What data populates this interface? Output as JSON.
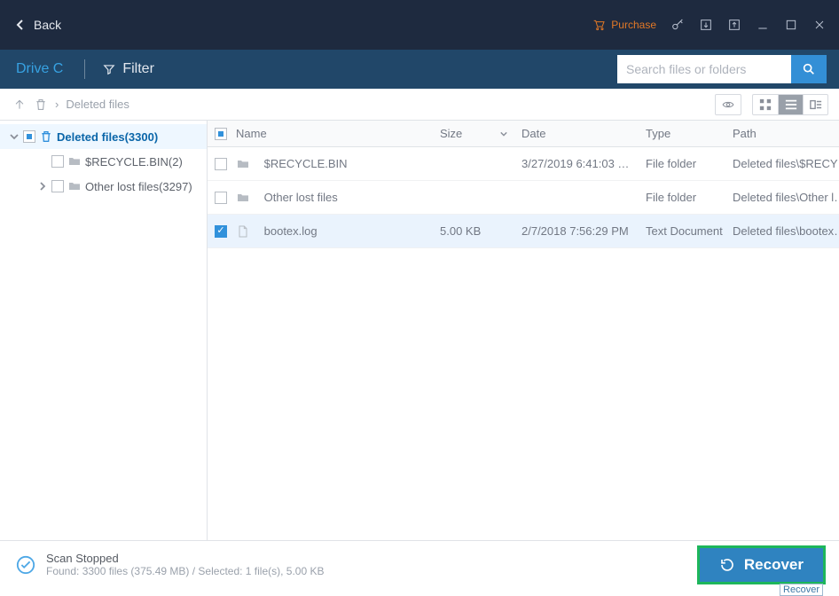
{
  "titlebar": {
    "back_label": "Back",
    "purchase_label": "Purchase"
  },
  "header": {
    "tab_label": "Drive C",
    "filter_label": "Filter"
  },
  "search": {
    "placeholder": "Search files or folders"
  },
  "crumb": {
    "current": "Deleted files",
    "sep": "›"
  },
  "sidebar": {
    "items": [
      {
        "label": "Deleted files(3300)",
        "type": "trash",
        "check": "partial",
        "expanded": true,
        "selected": true,
        "level": 0
      },
      {
        "label": "$RECYCLE.BIN(2)",
        "type": "folder",
        "check": "empty",
        "expanded": false,
        "selected": false,
        "level": 1
      },
      {
        "label": "Other lost files(3297)",
        "type": "folder",
        "check": "empty",
        "expanded": false,
        "selected": false,
        "level": 2,
        "caret": true
      }
    ]
  },
  "grid": {
    "columns": {
      "name": "Name",
      "size": "Size",
      "date": "Date",
      "type": "Type",
      "path": "Path"
    },
    "rows": [
      {
        "name": "$RECYCLE.BIN",
        "size": "",
        "date": "3/27/2019 6:41:03 …",
        "type": "File folder",
        "path": "Deleted files\\$RECY…",
        "icon": "folder",
        "check": "empty",
        "selected": false
      },
      {
        "name": "Other lost files",
        "size": "",
        "date": "",
        "type": "File folder",
        "path": "Deleted files\\Other l…",
        "icon": "folder",
        "check": "empty",
        "selected": false
      },
      {
        "name": "bootex.log",
        "size": "5.00 KB",
        "date": "2/7/2018 7:56:29 PM",
        "type": "Text Document",
        "path": "Deleted files\\bootex…",
        "icon": "file",
        "check": "checked",
        "selected": true
      }
    ]
  },
  "footer": {
    "status_title": "Scan Stopped",
    "status_detail": "Found: 3300 files (375.49 MB) / Selected: 1 file(s), 5.00 KB",
    "recover_label": "Recover",
    "recover_tooltip": "Recover"
  },
  "colors": {
    "accent": "#2f83c0",
    "highlight": "#1db65b"
  }
}
